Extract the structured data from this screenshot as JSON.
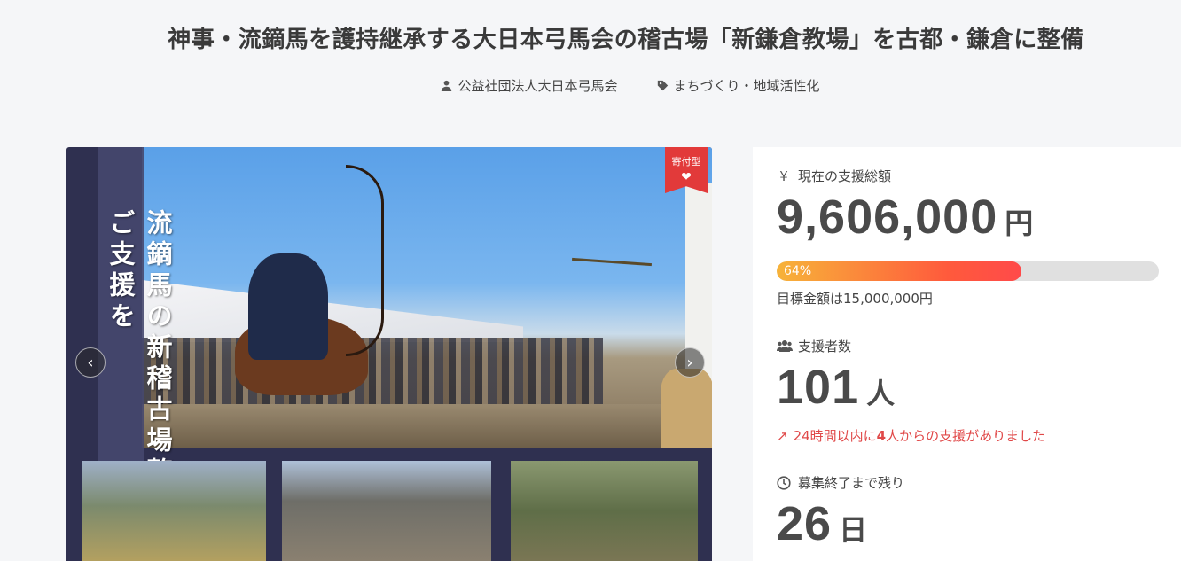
{
  "project": {
    "title": "神事・流鏑馬を護持継承する大日本弓馬会の稽古場「新鎌倉教場」を古都・鎌倉に整備",
    "owner": "公益社団法人大日本弓馬会",
    "category": "まちづくり・地域活性化"
  },
  "hero": {
    "badge_label": "寄付型",
    "badge_icon": "heart-hand-icon",
    "overlay_text": "流鏑馬の新稽古場整備にご支援を",
    "prev_icon": "chevron-left-icon",
    "next_icon": "chevron-right-icon"
  },
  "stats": {
    "total_label": "現在の支援総額",
    "total_icon": "yen-icon",
    "total_value": "9,606,000",
    "total_unit": "円",
    "progress_percent": 64,
    "progress_label": "64%",
    "goal_text": "目標金額は15,000,000円",
    "supporters_label": "支援者数",
    "supporters_icon": "users-icon",
    "supporters_value": "101",
    "supporters_unit": "人",
    "trend_prefix": "24時間以内に",
    "trend_count": "4",
    "trend_suffix": "人からの支援がありました",
    "trend_icon": "trending-up-icon",
    "remaining_label": "募集終了まで残り",
    "remaining_icon": "clock-icon",
    "remaining_value": "26",
    "remaining_unit": "日"
  },
  "colors": {
    "accent": "#e23a3a",
    "progress_start": "#f7b33a",
    "progress_end": "#ff4a4a",
    "background": "#f5f6f8"
  }
}
